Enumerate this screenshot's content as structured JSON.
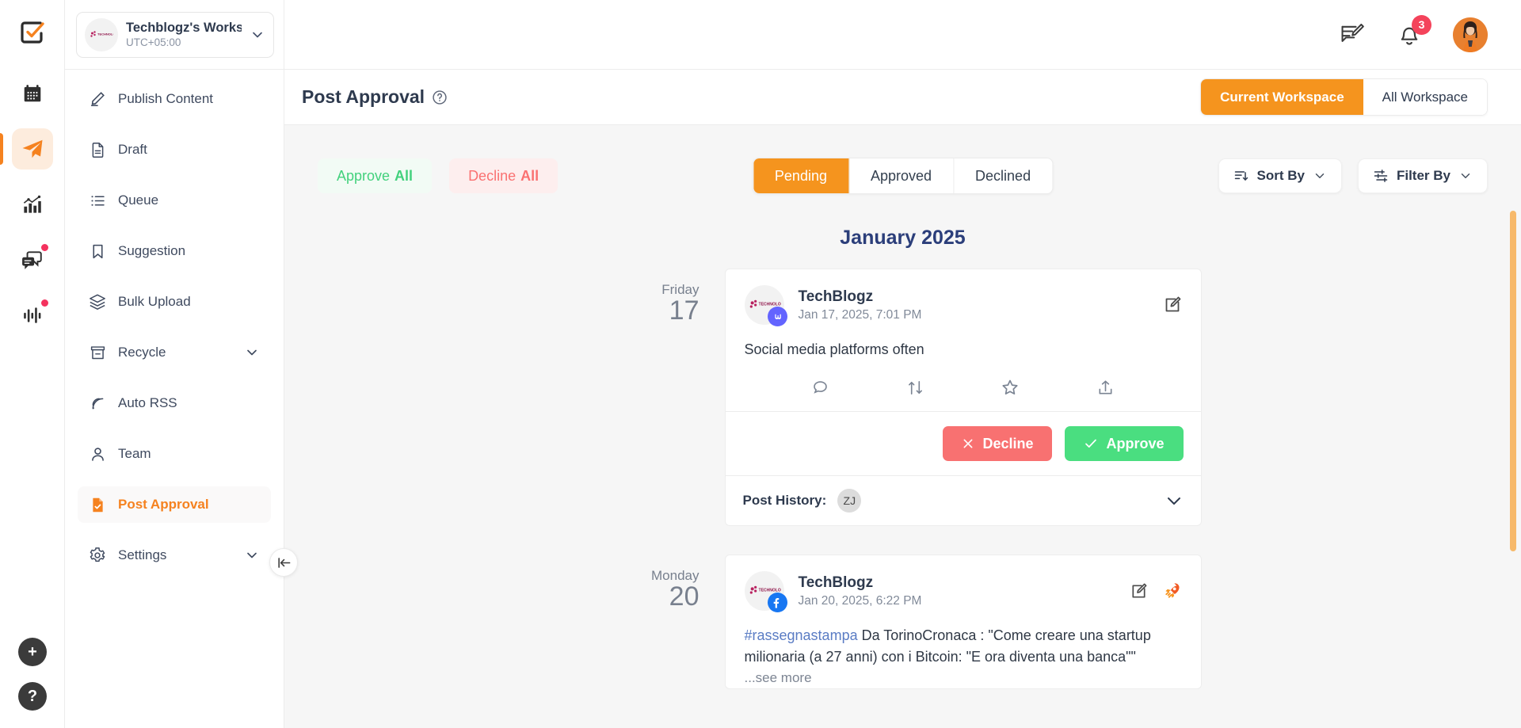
{
  "rail": {
    "logo_icon": "checkmark-square-logo",
    "items": [
      {
        "name": "calendar",
        "icon": "calendar-icon",
        "active": false,
        "dot": false
      },
      {
        "name": "publish",
        "icon": "paper-plane-icon",
        "active": true,
        "dot": false
      },
      {
        "name": "analytics",
        "icon": "bar-chart-icon",
        "active": false,
        "dot": false
      },
      {
        "name": "inbox",
        "icon": "chat-bubbles-icon",
        "active": false,
        "dot": true
      },
      {
        "name": "listening",
        "icon": "audio-waveform-icon",
        "active": false,
        "dot": true
      }
    ],
    "add_label": "+",
    "help_label": "?"
  },
  "workspace": {
    "name": "Techblogz's Worksp...",
    "timezone": "UTC+05:00",
    "avatar_icon": "technologo-avatar",
    "chevron_icon": "chevron-down-icon"
  },
  "sidebar": {
    "items": [
      {
        "label": "Publish Content",
        "icon": "pencil-icon",
        "active": false,
        "chevron": false
      },
      {
        "label": "Draft",
        "icon": "document-icon",
        "active": false,
        "chevron": false
      },
      {
        "label": "Queue",
        "icon": "list-icon",
        "active": false,
        "chevron": false
      },
      {
        "label": "Suggestion",
        "icon": "bookmark-icon",
        "active": false,
        "chevron": false
      },
      {
        "label": "Bulk Upload",
        "icon": "layers-icon",
        "active": false,
        "chevron": false
      },
      {
        "label": "Recycle",
        "icon": "archive-icon",
        "active": false,
        "chevron": true
      },
      {
        "label": "Auto RSS",
        "icon": "rss-icon",
        "active": false,
        "chevron": false
      },
      {
        "label": "Team",
        "icon": "user-icon",
        "active": false,
        "chevron": false
      },
      {
        "label": "Post Approval",
        "icon": "file-check-icon",
        "active": true,
        "chevron": false
      },
      {
        "label": "Settings",
        "icon": "gear-icon",
        "active": false,
        "chevron": true
      }
    ],
    "collapse_icon": "collapse-left-icon"
  },
  "topbar": {
    "compose_icon": "compose-message-icon",
    "notification_icon": "bell-icon",
    "notification_count": "3",
    "avatar_icon": "user-avatar"
  },
  "page": {
    "title": "Post Approval",
    "help_icon": "question-circle-icon",
    "workspace_scope": {
      "options": [
        "Current Workspace",
        "All Workspace"
      ],
      "selected": "Current Workspace"
    }
  },
  "toolbar": {
    "approve_all": "Approve",
    "approve_all_suffix": "All",
    "decline_all": "Decline",
    "decline_all_suffix": "All",
    "status_tabs": {
      "options": [
        "Pending",
        "Approved",
        "Declined"
      ],
      "selected": "Pending"
    },
    "sort_by": "Sort By",
    "sort_icon": "sort-descending-icon",
    "filter_by": "Filter By",
    "filter_icon": "filter-sliders-icon",
    "chevron_icon": "chevron-down-icon"
  },
  "feed": {
    "month_heading": "January 2025",
    "posts": [
      {
        "day_name": "Friday",
        "day_number": "17",
        "account": "TechBlogz",
        "timestamp": "Jan 17, 2025, 7:01 PM",
        "network": "mastodon",
        "network_icon": "mastodon-icon",
        "text": "Social media platforms often",
        "hashtag": "",
        "see_more": "",
        "head_actions": [
          "edit-icon"
        ],
        "engagement_icons": [
          "comment-icon",
          "boost-icon",
          "favorite-star-icon",
          "share-icon"
        ],
        "decline_label": "Decline",
        "approve_label": "Approve",
        "decline_icon": "close-x-icon",
        "approve_icon": "check-icon",
        "history_label": "Post History:",
        "history_chip": "ZJ",
        "history_chevron": "chevron-down-icon",
        "show_actions": true
      },
      {
        "day_name": "Monday",
        "day_number": "20",
        "account": "TechBlogz",
        "timestamp": "Jan 20, 2025, 6:22 PM",
        "network": "facebook",
        "network_icon": "facebook-icon",
        "hashtag": "#rassegnastampa",
        "text": " Da TorinoCronaca : \"Come creare una startup milionaria (a 27 anni) con i Bitcoin: \"E ora diventa una banca\"\"",
        "see_more": "...see more",
        "head_actions": [
          "edit-icon",
          "boost-rocket-icon"
        ],
        "show_actions": false
      }
    ]
  },
  "colors": {
    "accent": "#F5821F",
    "accent_button": "#F5941E",
    "approve_green": "#4ade80",
    "decline_red": "#f87171",
    "month_navy": "#2b3e7a",
    "scrollbar": "#f7b96a",
    "mastodon": "#6364ff",
    "facebook": "#1877f2"
  }
}
